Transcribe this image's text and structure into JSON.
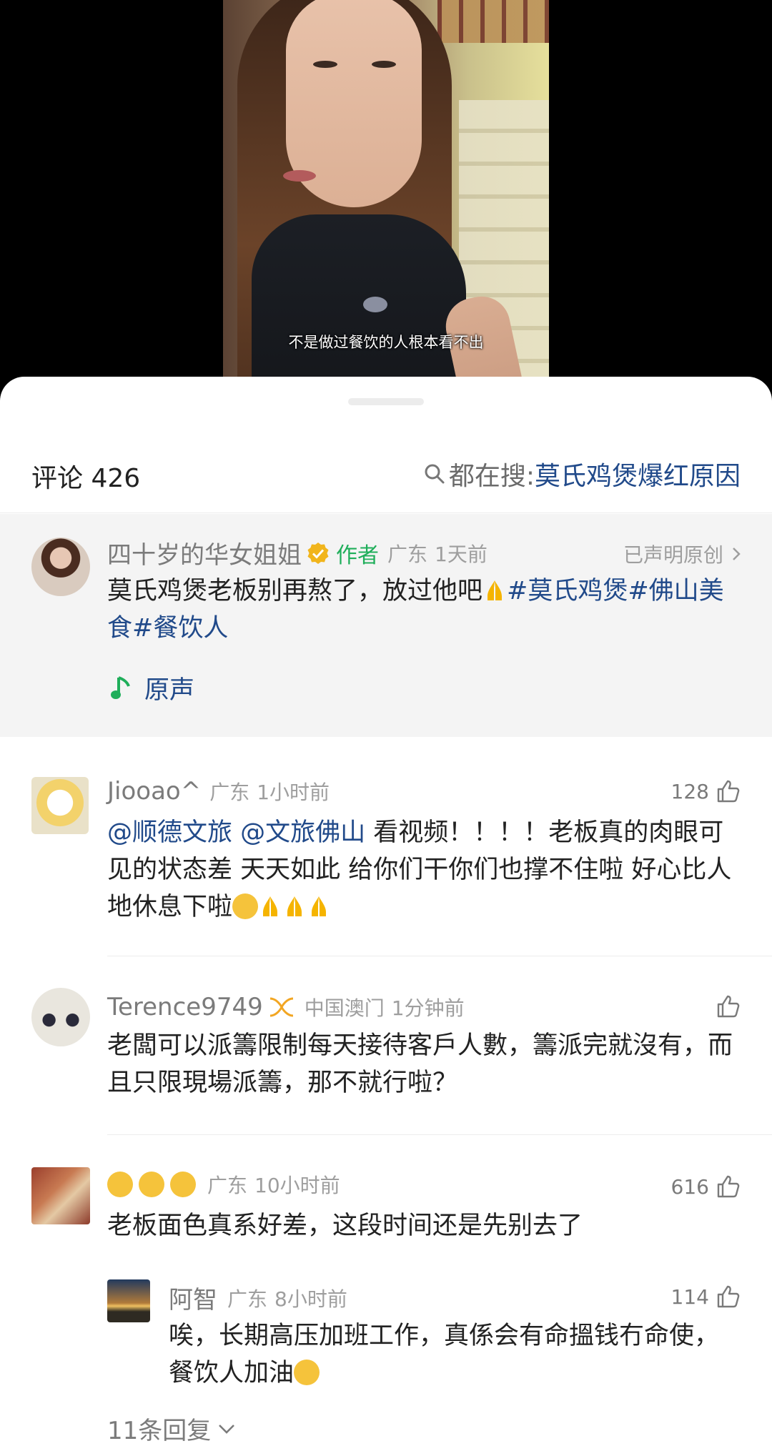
{
  "video": {
    "subtitle": "不是做过餐饮的人根本看不出"
  },
  "sheet": {
    "comments_label": "评论 426",
    "search_prefix": "都在搜: ",
    "search_term": "莫氏鸡煲爆红原因"
  },
  "author_post": {
    "username": "四十岁的华女姐姐",
    "badge": "作者",
    "location": "广东",
    "time": "1天前",
    "original_label": "已声明原创",
    "text": "莫氏鸡煲老板别再熬了，放过他吧",
    "hashtags": [
      "#莫氏鸡煲",
      "#佛山美食",
      "#餐饮人"
    ],
    "music_label": "原声"
  },
  "comments": [
    {
      "username": "Jiooao^",
      "location": "广东",
      "time": "1小时前",
      "likes": "128",
      "mentions": [
        "@顺德文旅",
        "@文旅佛山"
      ],
      "text": " 看视频！！！！老板真的肉眼可见的状态差 天天如此 给你们干你们也撑不住啦 好心比人地休息下啦"
    },
    {
      "username": "Terence9749",
      "location": "中国澳门",
      "time": "1分钟前",
      "likes": "",
      "text": "老闆可以派籌限制每天接待客戶人數，籌派完就沒有，而且只限現場派籌，那不就行啦？"
    },
    {
      "username": "",
      "location": "广东",
      "time": "10小时前",
      "likes": "616",
      "text": "老板面色真系好差，这段时间还是先别去了"
    }
  ],
  "reply": {
    "username": "阿智",
    "location": "广东",
    "time": "8小时前",
    "likes": "114",
    "text": "唉，长期高压加班工作，真係会有命搵钱冇命使，餐饮人加油"
  },
  "more_replies": "11条回复",
  "colors": {
    "link": "#214a8a",
    "author_badge": "#1fae5a",
    "verified": "#f1b51c",
    "muted": "#9e9e9e"
  },
  "icons": [
    "search-icon",
    "verified-icon",
    "music-note-icon",
    "chevron-right-icon",
    "thumbs-up-icon",
    "chevron-down-icon"
  ]
}
